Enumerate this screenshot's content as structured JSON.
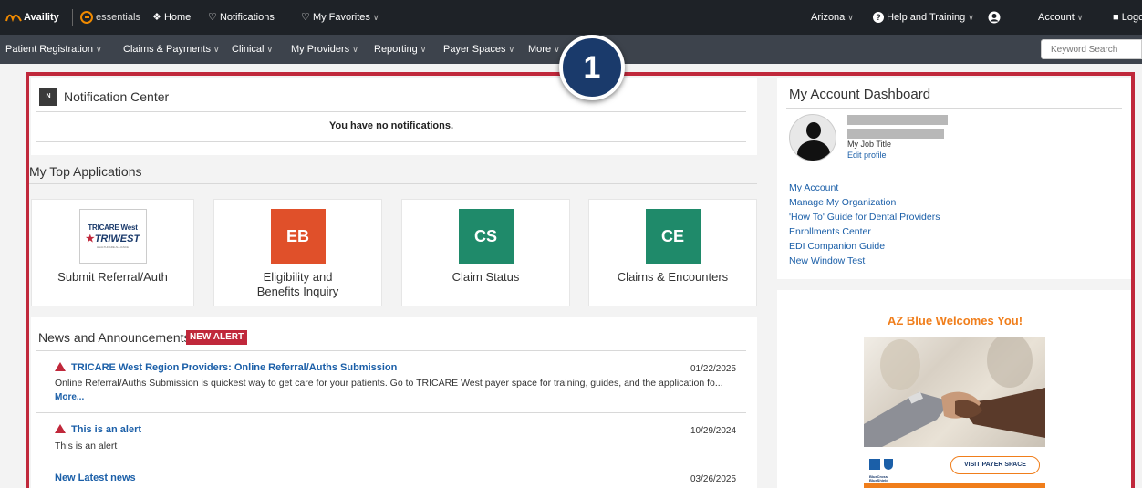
{
  "topbar": {
    "brand": "Availity",
    "essentials": "essentials",
    "home": "Home",
    "notifications": "Notifications",
    "favorites": "My Favorites",
    "state": "Arizona",
    "help": "Help and Training",
    "account": "Account",
    "logout": "Logo"
  },
  "nav": {
    "items": [
      "Patient Registration",
      "Claims & Payments",
      "Clinical",
      "My Providers",
      "Reporting",
      "Payer Spaces",
      "More"
    ],
    "search_placeholder": "Keyword Search"
  },
  "badge": "1",
  "notification_center": {
    "title": "Notification Center",
    "icon_letter": "N",
    "empty_message": "You have no notifications."
  },
  "top_apps": {
    "title": "My Top Applications",
    "apps": [
      {
        "label": "Submit Referral/Auth",
        "logo_line1": "TRICARE West",
        "logo_line2": "TRIWEST",
        "logo_line3": "HEALTHCARE ALLIANCE"
      },
      {
        "label": "Eligibility and Benefits Inquiry",
        "abbr": "EB",
        "color": "#e0502a"
      },
      {
        "label": "Claim Status",
        "abbr": "CS",
        "color": "#1f8a6a"
      },
      {
        "label": "Claims & Encounters",
        "abbr": "CE",
        "color": "#1f8a6a"
      }
    ]
  },
  "news": {
    "title": "News and Announcements",
    "alert_badge": "NEW ALERT",
    "items": [
      {
        "title": "TRICARE West Region Providers: Online Referral/Auths Submission",
        "date": "01/22/2025",
        "body": "Online Referral/Auths Submission is quickest way to get care for your patients. Go to TRICARE West payer space for training, guides, and the application fo...",
        "more": "More..."
      },
      {
        "title": "This is an alert",
        "date": "10/29/2024",
        "body": "This is an alert"
      },
      {
        "title": "New Latest news",
        "date": "03/26/2025"
      }
    ]
  },
  "account_dashboard": {
    "title": "My Account Dashboard",
    "job_title": "My Job Title",
    "edit_profile": "Edit profile",
    "links": [
      "My Account",
      "Manage My Organization",
      "'How To' Guide for Dental Providers",
      "Enrollments Center",
      "EDI Companion Guide",
      "New Window Test"
    ]
  },
  "promo": {
    "title": "AZ Blue Welcomes You!",
    "logo_text": "BlueCross BlueShield Arizona",
    "button": "VISIT PAYER SPACE"
  }
}
